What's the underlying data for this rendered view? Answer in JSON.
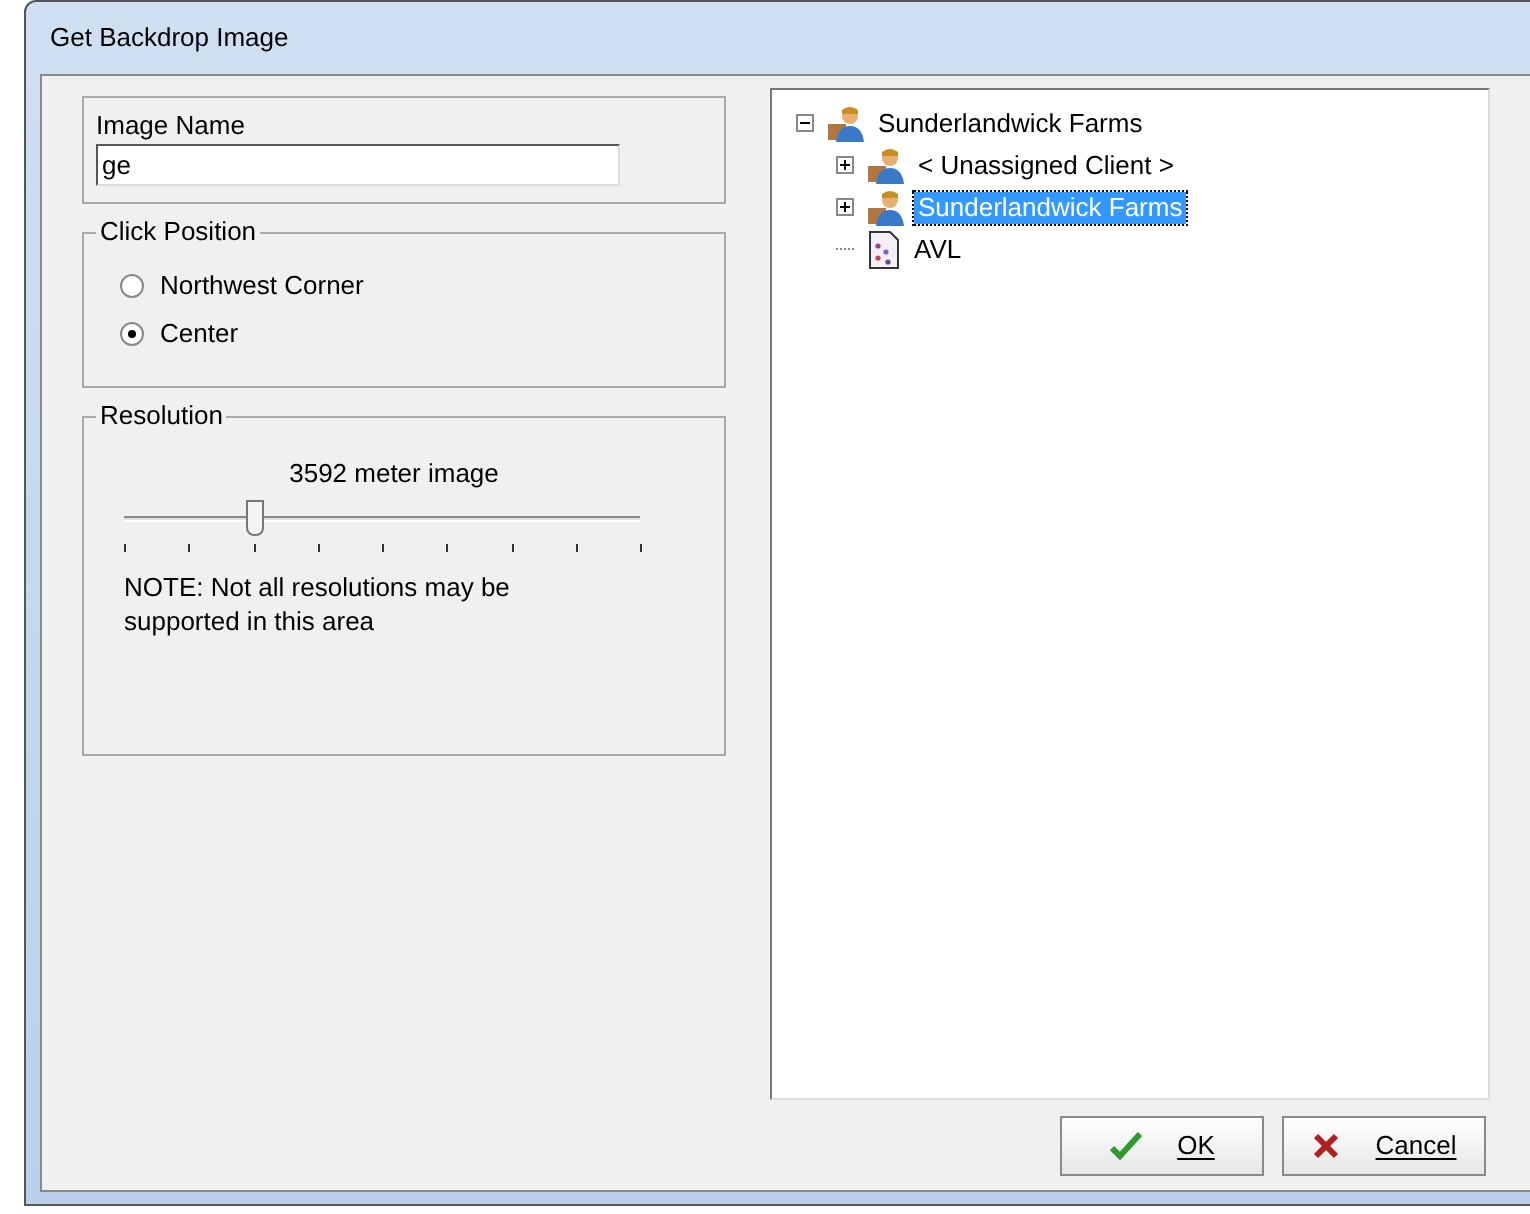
{
  "window": {
    "title": "Get Backdrop Image"
  },
  "image_name": {
    "label": "Image Name",
    "value": "ge"
  },
  "click_position": {
    "label": "Click Position",
    "options": [
      {
        "label": "Northwest Corner",
        "selected": false
      },
      {
        "label": "Center",
        "selected": true
      }
    ]
  },
  "resolution": {
    "label": "Resolution",
    "reading": "3592 meter image",
    "level": 0.25,
    "note": "NOTE: Not all resolutions may be supported in this area"
  },
  "tree": [
    {
      "label": "Sunderlandwick Farms",
      "kind": "client",
      "expanded": true,
      "selected": false,
      "children": [
        {
          "label": "< Unassigned Client >",
          "kind": "client",
          "expanded": false,
          "selected": false
        },
        {
          "label": "Sunderlandwick Farms",
          "kind": "client",
          "expanded": false,
          "selected": true
        },
        {
          "label": "AVL",
          "kind": "document",
          "selected": false
        }
      ]
    }
  ],
  "buttons": [
    {
      "label": "OK",
      "kind": "ok"
    },
    {
      "label": "Cancel",
      "kind": "cancel"
    }
  ]
}
